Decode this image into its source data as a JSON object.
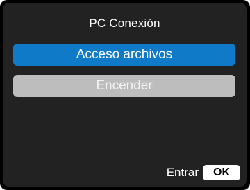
{
  "screen": {
    "title": "PC Conexión"
  },
  "menu": {
    "items": [
      {
        "label": "Acceso archivos",
        "selected": true
      },
      {
        "label": "Encender",
        "selected": false
      }
    ]
  },
  "footer": {
    "label": "Entrar",
    "ok_label": "OK"
  },
  "colors": {
    "background": "#000000",
    "panel": "#222222",
    "selected": "#0f7bc8",
    "unselected": "#bdbdbd",
    "text": "#ffffff"
  }
}
